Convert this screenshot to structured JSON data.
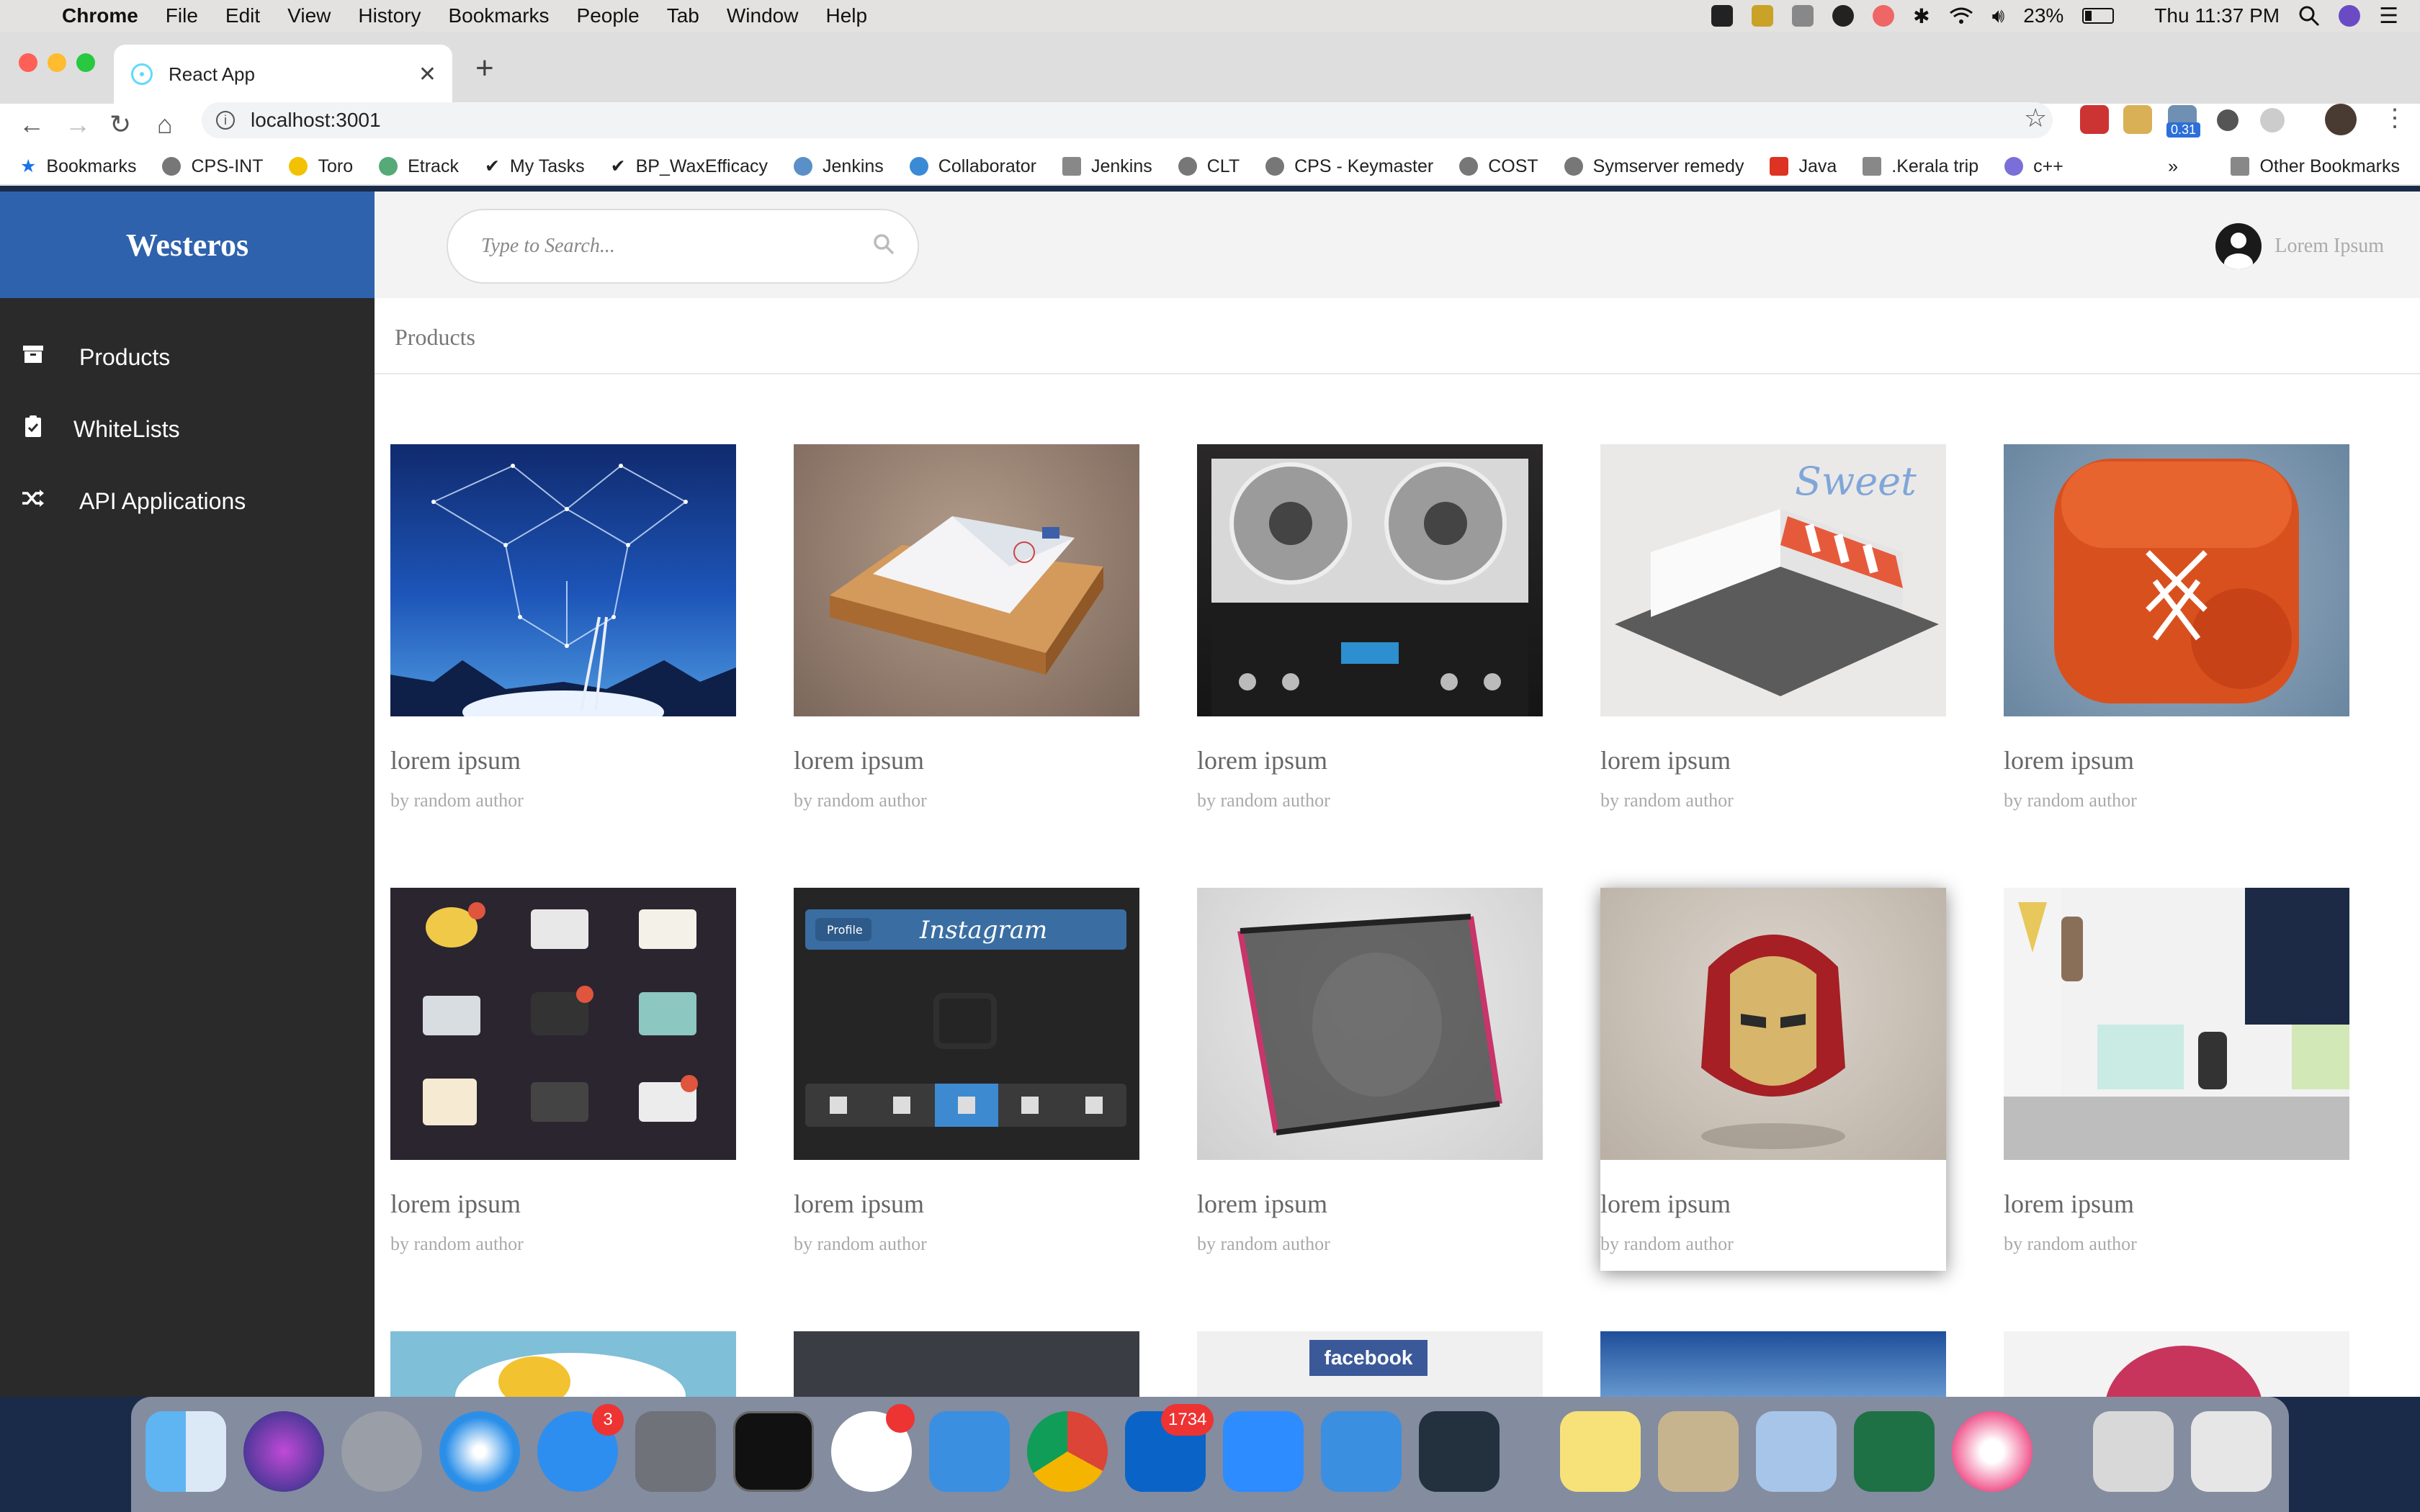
{
  "menubar": {
    "app": "Chrome",
    "items": [
      "File",
      "Edit",
      "View",
      "History",
      "Bookmarks",
      "People",
      "Tab",
      "Window",
      "Help"
    ],
    "battery": "23%",
    "clock": "Thu 11:37 PM"
  },
  "browser": {
    "tab_title": "React App",
    "url": "localhost:3001",
    "ext_badge": "0.31",
    "bookmarks": [
      "Bookmarks",
      "CPS-INT",
      "Toro",
      "Etrack",
      "My Tasks",
      "BP_WaxEfficacy",
      "Jenkins",
      "Collaborator",
      "Jenkins",
      "CLT",
      "CPS - Keymaster",
      "COST",
      "Symserver remedy",
      "Java",
      ".Kerala trip",
      "c++"
    ],
    "other_bookmarks": "Other Bookmarks",
    "more": "»"
  },
  "app": {
    "brand": "Westeros",
    "nav": [
      {
        "label": "Products",
        "icon": "archive-box-icon"
      },
      {
        "label": "WhiteLists",
        "icon": "clipboard-check-icon"
      },
      {
        "label": "API Applications",
        "icon": "shuffle-icon"
      }
    ],
    "search_placeholder": "Type to Search...",
    "user_name": "Lorem Ipsum",
    "breadcrumb": "Products",
    "products": [
      {
        "title": "lorem ipsum",
        "author": "by random author",
        "image": "constellation-box-image"
      },
      {
        "title": "lorem ipsum",
        "author": "by random author",
        "image": "mail-tray-image"
      },
      {
        "title": "lorem ipsum",
        "author": "by random author",
        "image": "tape-deck-image"
      },
      {
        "title": "lorem ipsum",
        "author": "by random author",
        "image": "sweet-shop-image"
      },
      {
        "title": "lorem ipsum",
        "author": "by random author",
        "image": "boxing-glove-image"
      },
      {
        "title": "lorem ipsum",
        "author": "by random author",
        "image": "app-icons-image"
      },
      {
        "title": "lorem ipsum",
        "author": "by random author",
        "image": "instagram-ui-image"
      },
      {
        "title": "lorem ipsum",
        "author": "by random author",
        "image": "pin-art-image"
      },
      {
        "title": "lorem ipsum",
        "author": "by random author",
        "image": "iron-helmet-image"
      },
      {
        "title": "lorem ipsum",
        "author": "by random author",
        "image": "web-layout-image"
      }
    ],
    "third_row": [
      "egg-image",
      "dark-ui-image",
      "facebook-image",
      "blue-website-image",
      "basketball-image"
    ],
    "facebook_text": "facebook",
    "instagram_text": "Instagram",
    "profile_text": "Profile",
    "sweet_text": "Sweet"
  },
  "dock": {
    "badges": {
      "app_store": "3",
      "outlook": "1734"
    }
  }
}
